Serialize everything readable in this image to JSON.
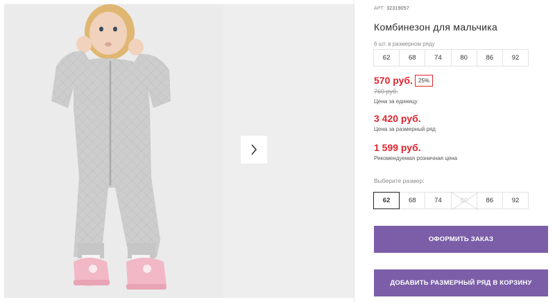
{
  "product": {
    "sku_label": "АРТ:",
    "sku_value": "32319057",
    "title": "Комбинезон для мальчика",
    "row_hint": "6 шт. в размерном ряду",
    "row_sizes": [
      "62",
      "68",
      "74",
      "80",
      "86",
      "92"
    ],
    "price_unit": "570 руб.",
    "discount_badge": "25%",
    "old_price": "760 руб.",
    "price_unit_label": "Цена за единицу",
    "price_row": "3 420 руб.",
    "price_row_label": "Цена за размерный ряд",
    "price_retail": "1 599 руб.",
    "price_retail_label": "Рекомендуемая розничная цена",
    "select_size_label": "Выберите размер:",
    "select_sizes": [
      {
        "label": "62",
        "state": "selected"
      },
      {
        "label": "68",
        "state": "available"
      },
      {
        "label": "74",
        "state": "available"
      },
      {
        "label": "80",
        "state": "unavailable"
      },
      {
        "label": "86",
        "state": "available"
      },
      {
        "label": "92",
        "state": "available"
      }
    ]
  },
  "buttons": {
    "order": "ОФОРМИТЬ ЗАКАЗ",
    "add_row": "ДОБАВИТЬ РАЗМЕРНЫЙ РЯД В КОРЗИНУ"
  },
  "colors": {
    "price": "#e0242e",
    "button": "#7b5ea7",
    "suit": "#cfcfcf",
    "shoes": "#f2b8c6"
  },
  "icons": {
    "gallery_next": "chevron-right-icon"
  }
}
